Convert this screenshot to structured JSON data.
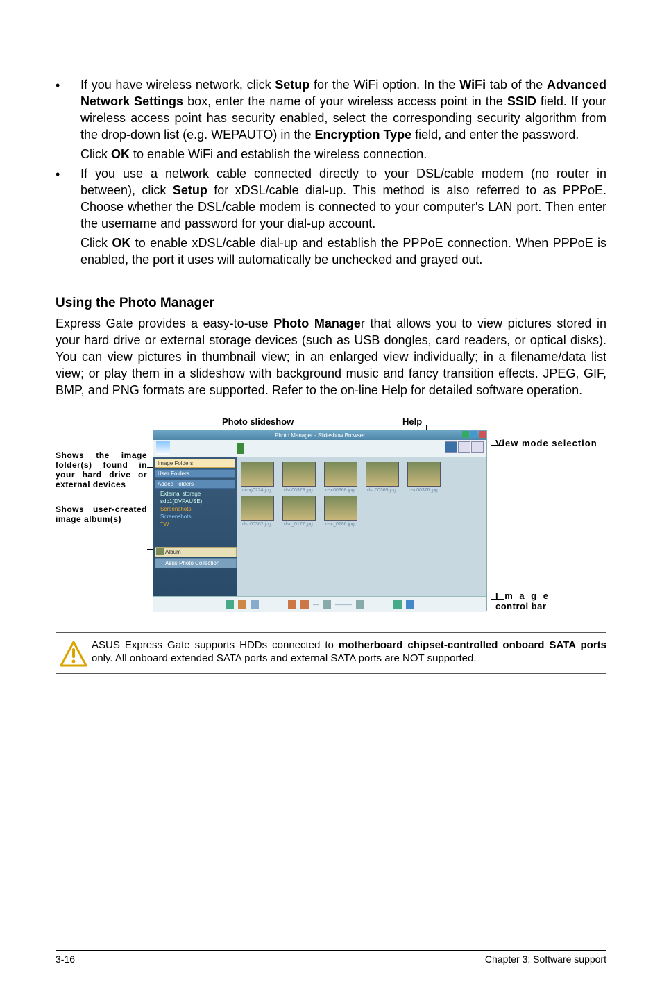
{
  "bullets": [
    {
      "main_html": "If you have wireless network, click <b>Setup</b> for the WiFi option. In the <b>WiFi</b> tab of the <b>Advanced Network Settings</b> box, enter the name of your wireless access point in the <b>SSID</b> field. If your wireless access point has security enabled, select the corresponding security algorithm from the drop-down list (e.g. WEPAUTO) in the <b>Encryption Type</b> field, and enter the password.",
      "sub_html": "Click <b>OK</b> to enable WiFi and establish the wireless connection."
    },
    {
      "main_html": "If you use a network cable connected directly to your DSL/cable modem (no router in between), click <b>Setup</b> for xDSL/cable dial-up. This method is also referred to as PPPoE. Choose whether the DSL/cable modem is connected to your computer's LAN port. Then enter the username and password for your dial-up account.",
      "sub_html": "Click <b>OK</b> to enable xDSL/cable dial-up and establish the PPPoE connection. When PPPoE is enabled, the port it uses will automatically be unchecked and grayed out."
    }
  ],
  "section_title": "Using the Photo Manager",
  "section_body_html": "Express Gate  provides a easy-to-use <b>Photo Manage</b>r that allows you to view pictures stored in your hard drive or external storage devices (such as USB dongles, card readers, or optical disks). You can view pictures in thumbnail view; in an enlarged view individually; in a filename/data list view; or play them in a slideshow with background music and fancy transition effects. JPEG, GIF, BMP, and PNG formats are supported. Refer to the on-line Help for detailed software operation.",
  "fig": {
    "top_labels": {
      "slideshow": "Photo slideshow",
      "help": "Help"
    },
    "left_labels": {
      "folders": "Shows the image folder(s) found in your hard drive or external devices",
      "albums": "Shows user-created image album(s)"
    },
    "right_labels": {
      "viewmode": "View mode selection",
      "imgctrl_line1": "I m a g e",
      "imgctrl_line2": "control bar"
    },
    "window_title": "Photo Manager - Slideshow Browser",
    "sidebar": {
      "image_folders": "Image Folders",
      "user_folders": "User Folders",
      "added_folders": "Added Folders",
      "external_storage": "External storage",
      "sdb1": "sdb1(DVPAUSE)",
      "screenshots": "Screenshots",
      "tw": "TW"
    },
    "albums": {
      "a1": "Album",
      "a2": "Asus Photo Collection"
    },
    "thumbs_row1": [
      "cimg0224.jpg",
      "dsc00373.jpg",
      "dsc00368.jpg",
      "dsc00369.jpg",
      "dsc00376.jpg"
    ],
    "thumbs_row2": [
      "dsc00362.jpg",
      "dsc_0177.jpg",
      "dsc_0186.jpg"
    ]
  },
  "note_html": "ASUS Express Gate supports HDDs connected to <b>motherboard chipset-controlled onboard SATA ports</b> only. All onboard extended SATA ports and external SATA ports are NOT supported.",
  "footer": {
    "left": "3-16",
    "right": "Chapter 3: Software support"
  }
}
